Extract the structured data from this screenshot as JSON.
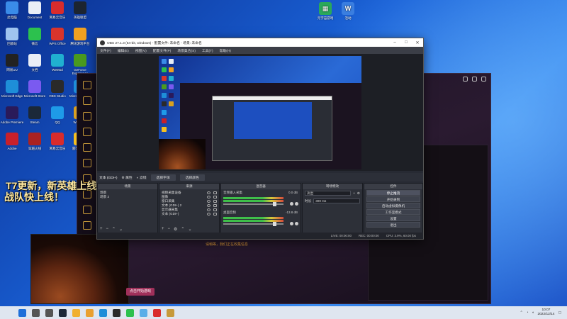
{
  "desktop": {
    "left_icons": [
      {
        "label": "此电脑",
        "icon": "computer-icon",
        "color": "#3a8be8"
      },
      {
        "label": "Document",
        "icon": "document-icon",
        "color": "#e9eef6"
      },
      {
        "label": "网易云音乐",
        "icon": "netease-music-icon",
        "color": "#d92c2c"
      },
      {
        "label": "英雄联盟",
        "icon": "game-icon",
        "color": "#1c2430"
      },
      {
        "label": "回收站",
        "icon": "recycle-bin-icon",
        "color": "#9fc4ef"
      },
      {
        "label": "微信",
        "icon": "wechat-icon",
        "color": "#2cc14e"
      },
      {
        "label": "WPS Office",
        "icon": "wps-icon",
        "color": "#d9342b"
      },
      {
        "label": "腾讯游戏平台",
        "icon": "tencent-game-icon",
        "color": "#f0a020"
      },
      {
        "label": "网易UU",
        "icon": "uu-icon",
        "color": "#222"
      },
      {
        "label": "文档",
        "icon": "file-icon",
        "color": "#e9eef6"
      },
      {
        "label": "WeMod",
        "icon": "wemod-icon",
        "color": "#20b0d0"
      },
      {
        "label": "GeForce Experience",
        "icon": "nvidia-icon",
        "color": "#4a9a1e"
      },
      {
        "label": "Microsoft Edge",
        "icon": "edge-icon",
        "color": "#1e8ed8"
      },
      {
        "label": "Microsoft Store",
        "icon": "store-icon",
        "color": "#7a5af0"
      },
      {
        "label": "OBS Studio",
        "icon": "obs-icon",
        "color": "#2a2a2a"
      },
      {
        "label": "Microsoft Edge",
        "icon": "edge-icon",
        "color": "#1e8ed8"
      },
      {
        "label": "Adobe Premiere",
        "icon": "premiere-icon",
        "color": "#2a1a5a"
      },
      {
        "label": "Steam",
        "icon": "steam-icon",
        "color": "#1b2838"
      },
      {
        "label": "QQ",
        "icon": "qq-icon",
        "color": "#1e9ae8"
      },
      {
        "label": "WeGame",
        "icon": "wegame-icon",
        "color": "#d8a020"
      },
      {
        "label": "Adobe",
        "icon": "adobe-icon",
        "color": "#c8202a"
      },
      {
        "label": "穿越火线",
        "icon": "game2-icon",
        "color": "#aa2222"
      },
      {
        "label": "网易云音乐",
        "icon": "netease-music-icon",
        "color": "#d92c2c"
      },
      {
        "label": "雷电模拟器",
        "icon": "emulator-icon",
        "color": "#f5c020"
      }
    ],
    "top_icons": [
      {
        "label": "元宇宙游戏",
        "icon": "spreadsheet-icon",
        "color": "#2aa85a"
      },
      {
        "label": "活动",
        "icon": "doc-icon",
        "color": "#3a7ee0"
      }
    ]
  },
  "background_app": {
    "overlay_line1": "T7更新，新英雄上线！",
    "overlay_line2": "战队快上线！",
    "status_text": "请稍等，我们正在收集信息",
    "button_label": "点击开始游戏"
  },
  "obs": {
    "title": "OBS 27.1.3 (64-bit, windows) - 配置文件: 未命名 - 场景: 未命名",
    "menu": [
      "文件(F)",
      "编辑(E)",
      "视图(V)",
      "配置文件(P)",
      "场景集合(S)",
      "工具(T)",
      "帮助(H)"
    ],
    "source_bar": {
      "selected_source": "文本 (GDI+)",
      "buttons": [
        "属性",
        "滤镜"
      ],
      "tabs": [
        "选择字体",
        "选择颜色"
      ]
    },
    "docks": {
      "scenes": {
        "title": "场景",
        "items": [
          "场景",
          "场景 2"
        ]
      },
      "sources": {
        "title": "来源",
        "items": [
          "视频采集设备",
          "图像",
          "窗口采集",
          "文本 (GDI+) 2",
          "显示器采集",
          "文本 (GDI+)"
        ]
      },
      "mixer": {
        "title": "混音器",
        "channels": [
          {
            "name": "音频输入采集",
            "db": "0.0 dB"
          },
          {
            "name": "桌面音频",
            "db": "-13.8 dB"
          }
        ]
      },
      "transitions": {
        "title": "转场特效",
        "type": "淡出",
        "duration_label": "时长",
        "duration_value": "300 ms"
      },
      "controls": {
        "title": "控件",
        "buttons": [
          "停止推流",
          "开始录制",
          "启动虚拟摄像机",
          "工作室模式",
          "设置",
          "退出"
        ]
      }
    },
    "status": {
      "live": "LIVE: 00:00:00",
      "rec": "REC: 00:00:00",
      "cpu": "CPU: 3.9%, 60.00 fps"
    }
  },
  "taskbar": {
    "apps": [
      {
        "icon": "start-icon",
        "color": "#1e6fd9"
      },
      {
        "icon": "search-icon",
        "color": "#555"
      },
      {
        "icon": "task-view-icon",
        "color": "#555"
      },
      {
        "icon": "steam-icon",
        "color": "#1b2838"
      },
      {
        "icon": "explorer-icon",
        "color": "#f0b030"
      },
      {
        "icon": "file-icon",
        "color": "#e9a030"
      },
      {
        "icon": "store-icon",
        "color": "#1e8ed8"
      },
      {
        "icon": "obs-icon",
        "color": "#2a2a2a"
      },
      {
        "icon": "wechat-icon",
        "color": "#2cc14e"
      },
      {
        "icon": "app-icon",
        "color": "#5aaee8"
      },
      {
        "icon": "netease-music-icon",
        "color": "#d92c2c"
      },
      {
        "icon": "game-icon",
        "color": "#c79a3a"
      }
    ],
    "time": "10:07",
    "date": "2022/12/14"
  }
}
